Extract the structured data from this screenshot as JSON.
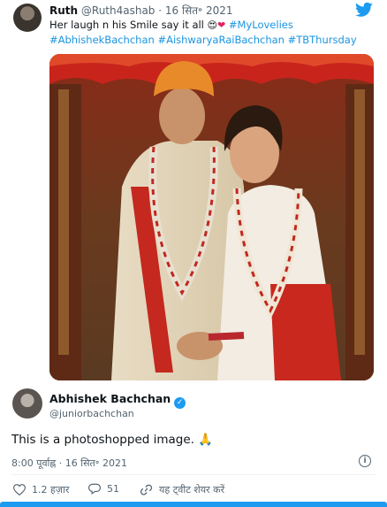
{
  "quoted_tweet": {
    "name": "Ruth",
    "handle": "@Ruth4ashab",
    "date": "16 सित॰ 2021",
    "text_plain": "Her laugh n his Smile say it all",
    "emoji_1": "😍",
    "emoji_2": "❤",
    "hashtag_1": "#MyLovelies",
    "hashtag_2": "#AbhishekBachchan",
    "hashtag_3": "#AishwaryaRaiBachchan",
    "hashtag_4": "#TBThursday"
  },
  "tweet": {
    "name": "Abhishek Bachchan",
    "verified": "✓",
    "handle": "@juniorbachchan",
    "text": "This is a photoshopped image.",
    "emoji": "🙏",
    "timestamp": "8:00 पूर्वाह्न · 16 सित॰ 2021",
    "info": "i"
  },
  "actions": {
    "likes": "1.2 हज़ार",
    "replies": "51",
    "share_label": "यह ट्वीट शेयर करें"
  },
  "icons": {
    "brand": "twitter-bird-icon",
    "like": "heart-icon",
    "reply": "reply-bubble-icon",
    "share": "link-icon",
    "info": "info-icon"
  },
  "colors": {
    "brand_blue": "#1d9bf0",
    "hashtag": "#1b95e0",
    "muted_text": "#536471"
  }
}
